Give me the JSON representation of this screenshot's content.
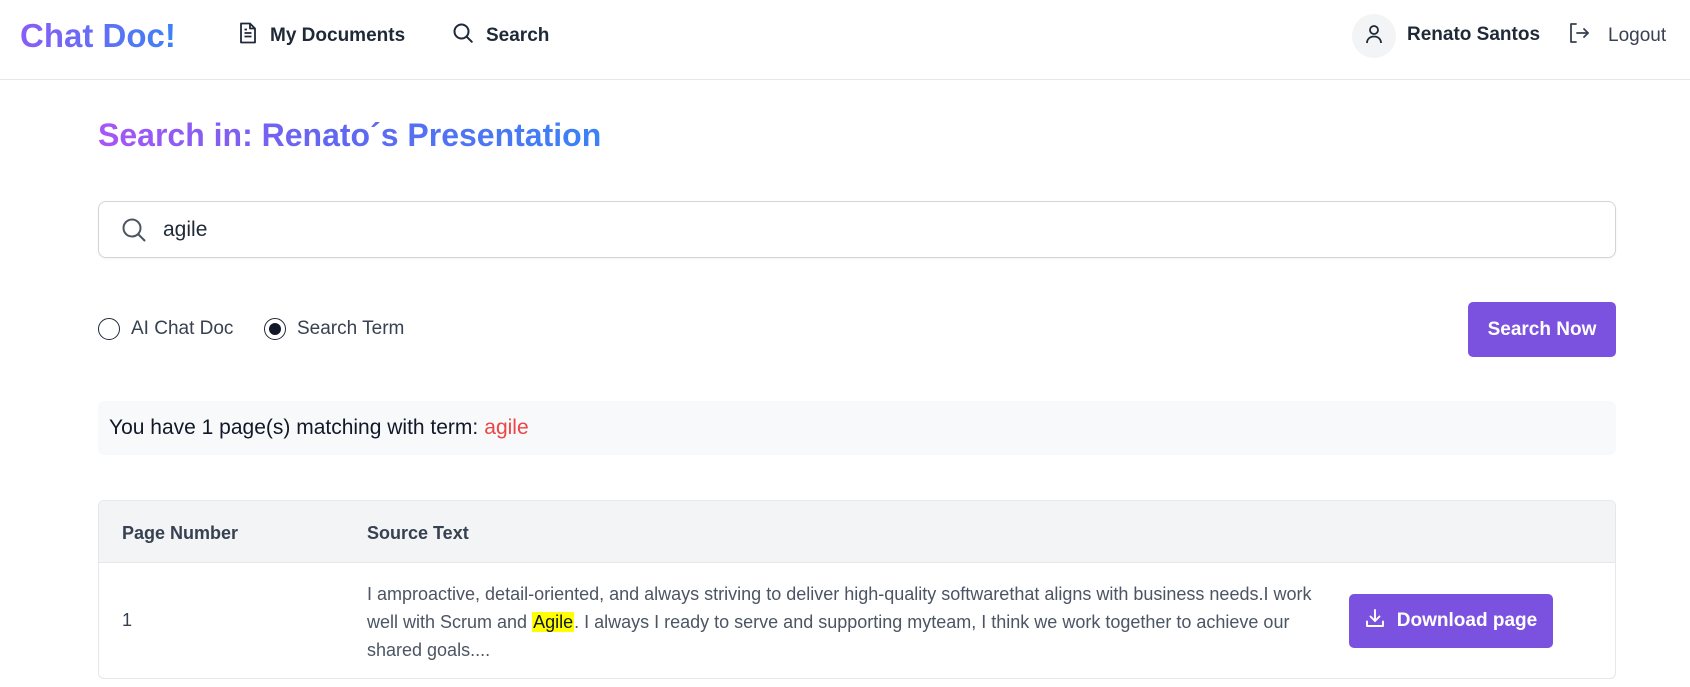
{
  "nav": {
    "brand": "Chat Doc!",
    "my_documents": "My Documents",
    "search": "Search",
    "user_name": "Renato Santos",
    "logout": "Logout"
  },
  "page": {
    "title": "Search in: Renato´s Presentation"
  },
  "search": {
    "value": "agile",
    "placeholder": ""
  },
  "options": [
    {
      "label": "AI Chat Doc",
      "selected": false
    },
    {
      "label": "Search Term",
      "selected": true
    }
  ],
  "search_button": "Search Now",
  "result": {
    "message": "You have 1 page(s) matching with term:",
    "term": "agile"
  },
  "table": {
    "headers": [
      "Page Number",
      "Source Text"
    ],
    "rows": [
      {
        "page": "1",
        "text_before": "I amproactive, detail-oriented, and always striving to deliver high-quality softwarethat aligns with business needs.I work well with Scrum and ",
        "highlight": "Agile",
        "text_after": ". I always I ready to serve and supporting myteam, I think we work together to achieve our shared goals....",
        "action": "Download page"
      }
    ]
  },
  "colors": {
    "accent": "#7b52e0",
    "brand_gradient_start": "#8b5cf6",
    "brand_gradient_end": "#3b82f6",
    "term_color": "#ef4444",
    "highlight": "#ffff00"
  },
  "icons": [
    "document-icon",
    "search-icon",
    "user-icon",
    "logout-icon",
    "download-icon"
  ]
}
